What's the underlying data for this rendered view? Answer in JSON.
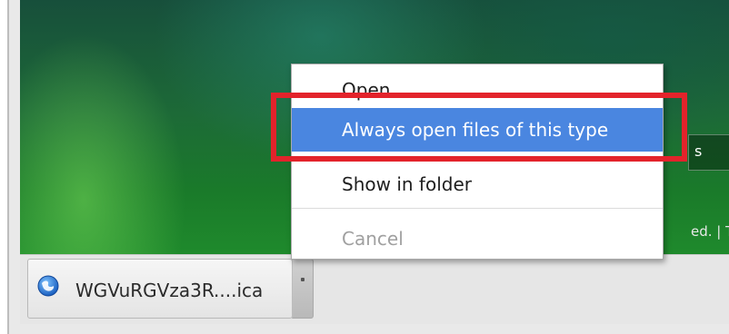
{
  "page": {
    "button_fragment": "s",
    "footer_fragment": "ed. | Thi"
  },
  "download_shelf": {
    "item": {
      "file_name": "WGVuRGVza3R....ica",
      "icon": "globe-icon"
    },
    "dropdown_icon": "dropdown-arrow-icon"
  },
  "context_menu": {
    "items": [
      {
        "label": "Open",
        "state": "normal"
      },
      {
        "label": "Always open files of this type",
        "state": "highlighted"
      },
      {
        "label": "Show in folder",
        "state": "normal"
      },
      {
        "label": "Cancel",
        "state": "disabled"
      }
    ]
  },
  "colors": {
    "menu_highlight": "#4a86e0",
    "annotation_box": "#e3232b"
  }
}
